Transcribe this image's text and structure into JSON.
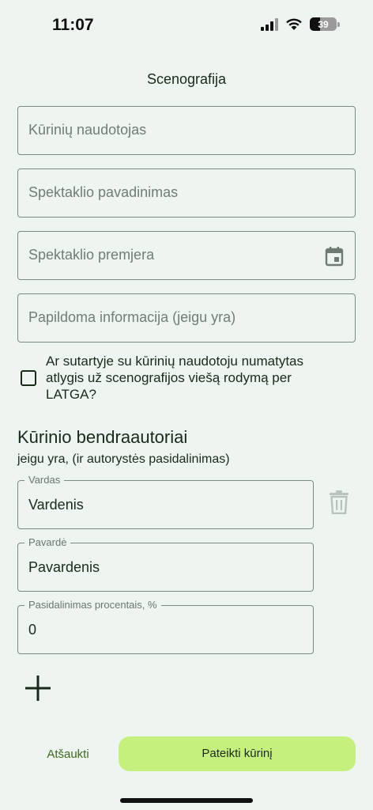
{
  "status": {
    "time": "11:07",
    "battery": "39",
    "battery_level": 0.39
  },
  "page": {
    "title": "Scenografija"
  },
  "fields": {
    "work_user": {
      "placeholder": "Kūrinių naudotojas"
    },
    "performance_name": {
      "placeholder": "Spektaklio pavadinimas"
    },
    "premiere": {
      "placeholder": "Spektaklio premjera"
    },
    "additional_info": {
      "placeholder": "Papildoma informacija (jeigu yra)"
    }
  },
  "checkbox": {
    "label": "Ar sutartyje su kūrinių naudotoju numatytas atlygis už scenografijos viešą rodymą per LATGA?",
    "checked": false
  },
  "coauthors": {
    "title": "Kūrinio bendraautoriai",
    "subtitle": "jeigu yra, (ir autorystės pasidalinimas)",
    "first_name": {
      "label": "Vardas",
      "value": "Vardenis"
    },
    "last_name": {
      "label": "Pavardė",
      "value": "Pavardenis"
    },
    "share": {
      "label": "Pasidalinimas procentais, %",
      "value": "0"
    }
  },
  "actions": {
    "cancel": "Atšaukti",
    "submit": "Pateikti kūrinį"
  },
  "colors": {
    "background": "#eef4f0",
    "primary_button": "#c6f07e",
    "accent_text": "#3e6a1e"
  }
}
